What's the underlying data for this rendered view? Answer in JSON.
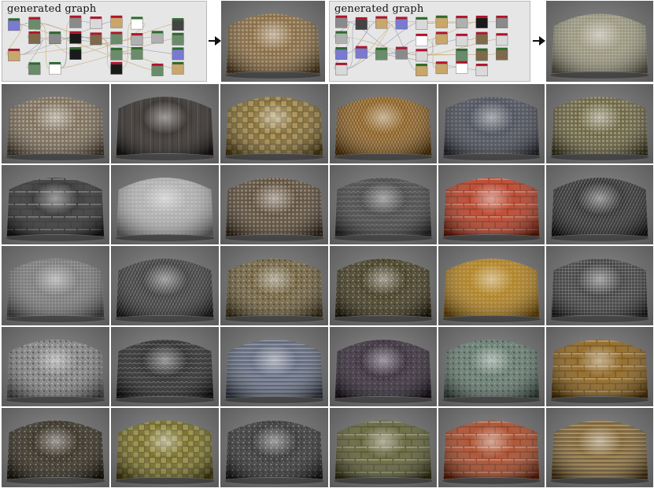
{
  "graphs": [
    {
      "id": "graph-1",
      "title": "generated graph"
    },
    {
      "id": "graph-2",
      "title": "generated graph"
    }
  ],
  "materials": [
    {
      "name": "result-1",
      "base": "#7a5a30",
      "light": "#f0d9a0",
      "pattern": "dots"
    },
    {
      "name": "result-2",
      "base": "#8c8870",
      "light": "#f2efd0",
      "pattern": "grid"
    },
    {
      "name": "r1c1",
      "base": "#6e5e48",
      "light": "#f4e7cf",
      "pattern": "dots"
    },
    {
      "name": "r1c2",
      "base": "#2a2420",
      "light": "#cfcfcf",
      "pattern": "planks"
    },
    {
      "name": "r1c3",
      "base": "#7a6023",
      "light": "#e9cf7a",
      "pattern": "checker"
    },
    {
      "name": "r1c4",
      "base": "#8a5a18",
      "light": "#e8b05c",
      "pattern": "herring"
    },
    {
      "name": "r1c5",
      "base": "#3b3f4a",
      "light": "#8d93a4",
      "pattern": "dots"
    },
    {
      "name": "r1c6",
      "base": "#5a5230",
      "light": "#e4dca0",
      "pattern": "dots"
    },
    {
      "name": "r2c1",
      "base": "#2a2a2a",
      "light": "#7d7d7d",
      "pattern": "bricks"
    },
    {
      "name": "r2c2",
      "base": "#a8a8a8",
      "light": "#f5f5f5",
      "pattern": "dots"
    },
    {
      "name": "r2c3",
      "base": "#4a3a28",
      "light": "#d8c09a",
      "pattern": "dots"
    },
    {
      "name": "r2c4",
      "base": "#3a3a3a",
      "light": "#8e8e8e",
      "pattern": "scales"
    },
    {
      "name": "r2c5",
      "base": "#b8361a",
      "light": "#f1865c",
      "pattern": "bricks"
    },
    {
      "name": "r2c6",
      "base": "#1e1e1e",
      "light": "#9c9c9c",
      "pattern": "herring"
    },
    {
      "name": "r3c1",
      "base": "#6b6b6b",
      "light": "#d9d9d9",
      "pattern": "grid"
    },
    {
      "name": "r3c2",
      "base": "#2f2f2f",
      "light": "#9b9b9b",
      "pattern": "herring"
    },
    {
      "name": "r3c3",
      "base": "#6a5a36",
      "light": "#efe0a8",
      "pattern": "noise"
    },
    {
      "name": "r3c4",
      "base": "#3a3218",
      "light": "#f3e19a",
      "pattern": "noise"
    },
    {
      "name": "r3c5",
      "base": "#a87410",
      "light": "#f7c64a",
      "pattern": "dots"
    },
    {
      "name": "r3c6",
      "base": "#2a2a2a",
      "light": "#f0f0f0",
      "pattern": "grid"
    },
    {
      "name": "r4c1",
      "base": "#7c7c7c",
      "light": "#ededed",
      "pattern": "noise"
    },
    {
      "name": "r4c2",
      "base": "#1c1c1c",
      "light": "#9a9a9a",
      "pattern": "scales"
    },
    {
      "name": "r4c3",
      "base": "#5a6378",
      "light": "#b2bbd0",
      "pattern": "lines"
    },
    {
      "name": "r4c4",
      "base": "#2c2230",
      "light": "#8c7a88",
      "pattern": "noise"
    },
    {
      "name": "r4c5",
      "base": "#5d7468",
      "light": "#a9c0b3",
      "pattern": "noise"
    },
    {
      "name": "r4c6",
      "base": "#8a5c10",
      "light": "#f4c860",
      "pattern": "bricks"
    },
    {
      "name": "r5c1",
      "base": "#2a2418",
      "light": "#f0d79a",
      "pattern": "noise"
    },
    {
      "name": "r5c2",
      "base": "#6a6018",
      "light": "#d7cd62",
      "pattern": "checker"
    },
    {
      "name": "r5c3",
      "base": "#2c2c2c",
      "light": "#d0d0d0",
      "pattern": "noise"
    },
    {
      "name": "r5c4",
      "base": "#5a5a2c",
      "light": "#c8c890",
      "pattern": "bricks"
    },
    {
      "name": "r5c5",
      "base": "#a8401c",
      "light": "#ef8a5a",
      "pattern": "bricks"
    },
    {
      "name": "r5c6",
      "base": "#7a5c28",
      "light": "#e8c886",
      "pattern": "lines"
    }
  ],
  "colors": {
    "background_tile": "#767676",
    "arrow": "#111111",
    "graph_panel": "#e6e6e6"
  }
}
